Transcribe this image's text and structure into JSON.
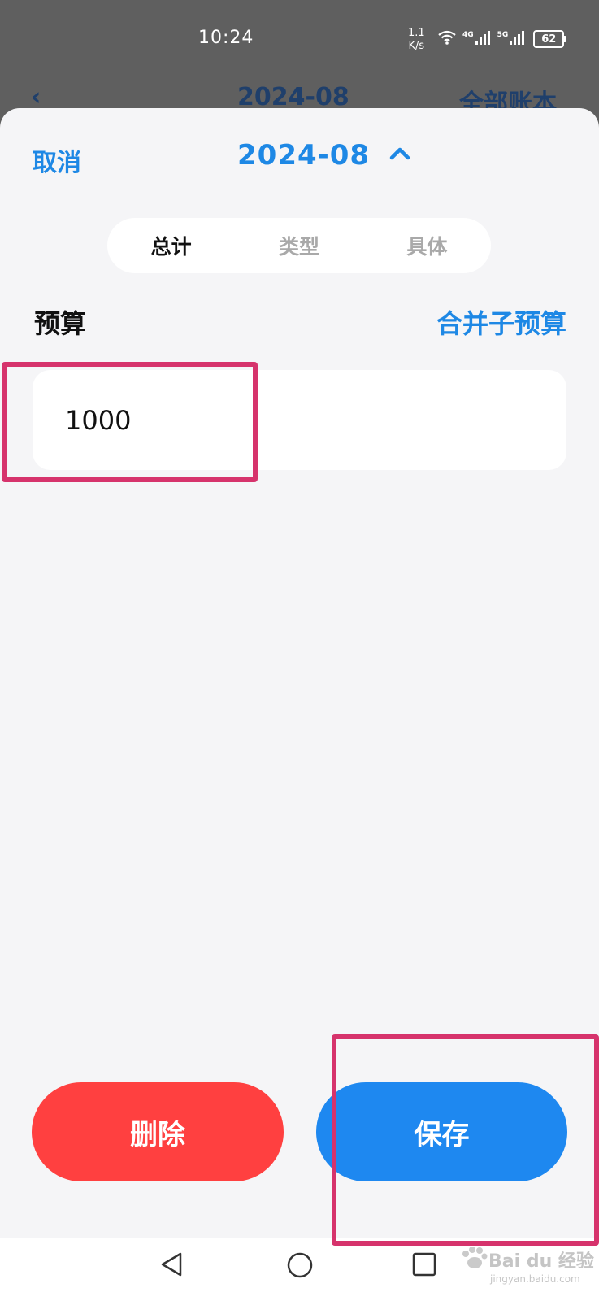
{
  "status_bar": {
    "time": "10:24",
    "speed_value": "1.1",
    "speed_unit": "K/s",
    "network_1": "4G",
    "network_2": "5G",
    "battery": "62"
  },
  "background_header": {
    "date": "2024-08",
    "right_label": "全部账本"
  },
  "sheet_header": {
    "cancel_label": "取消",
    "month": "2024-08"
  },
  "tabs": [
    {
      "label": "总计",
      "active": true
    },
    {
      "label": "类型",
      "active": false
    },
    {
      "label": "具体",
      "active": false
    }
  ],
  "budget": {
    "label": "预算",
    "merge_label": "合并子预算",
    "value": "1000"
  },
  "actions": {
    "delete_label": "删除",
    "save_label": "保存"
  },
  "watermark": {
    "text": "Bai du 经验",
    "sub": "jingyan.baidu.com"
  },
  "colors": {
    "accent": "#1e88e5",
    "delete": "#ff4040",
    "save": "#1e88f0",
    "highlight": "#d6336c"
  }
}
